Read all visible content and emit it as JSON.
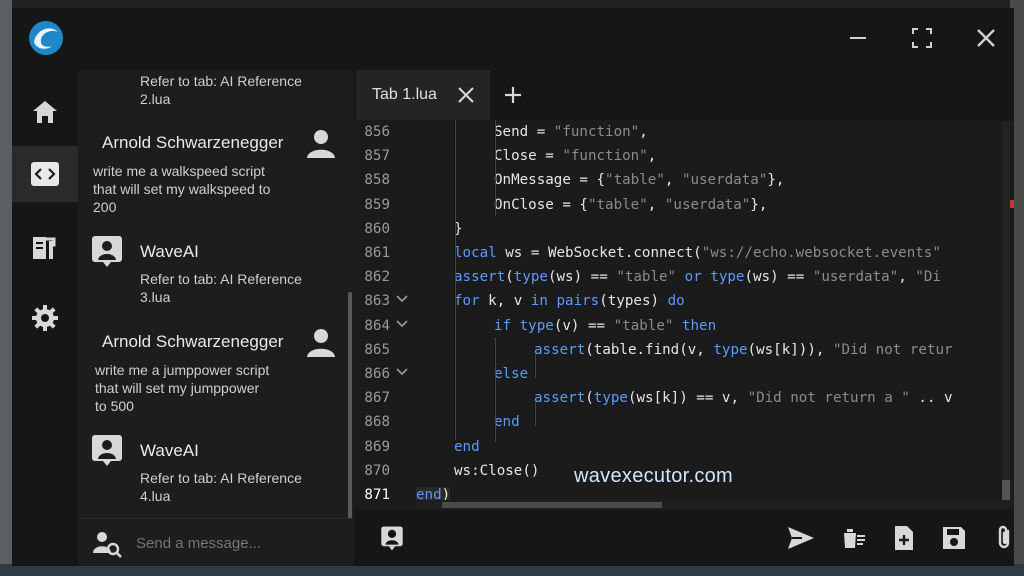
{
  "window": {
    "controls": {
      "minimize_icon": "minimize-icon",
      "maximize_icon": "maximize-icon",
      "close_icon": "close-icon"
    }
  },
  "nav": {
    "items": [
      {
        "name": "home",
        "icon": "home-icon"
      },
      {
        "name": "editor",
        "icon": "code-icon",
        "active": true
      },
      {
        "name": "scripts",
        "icon": "script-hub-icon"
      },
      {
        "name": "settings",
        "icon": "gear-icon"
      }
    ]
  },
  "chat": {
    "messages": [
      {
        "sender": "",
        "text": "Refer to tab: AI Reference\n2.lua"
      },
      {
        "sender": "Arnold Schwarzenegger",
        "text": "write me a walkspeed script\nthat will set my walkspeed to\n200"
      },
      {
        "sender": "WaveAI",
        "text": "Refer to tab: AI Reference\n3.lua"
      },
      {
        "sender": "Arnold Schwarzenegger",
        "text": "write me a jumppower script\nthat will set my jumppower\nto 500"
      },
      {
        "sender": "WaveAI",
        "text": "Refer to tab: AI Reference\n4.lua"
      }
    ],
    "input_placeholder": "Send a message..."
  },
  "editor": {
    "tabs": [
      {
        "label": "Tab 1.lua"
      }
    ],
    "lines": [
      {
        "n": "856",
        "fold": "",
        "indent": 2,
        "html": "Send = <span class=\"str\">\"function\"</span>,"
      },
      {
        "n": "857",
        "fold": "",
        "indent": 2,
        "html": "Close = <span class=\"str\">\"function\"</span>,"
      },
      {
        "n": "858",
        "fold": "",
        "indent": 2,
        "html": "OnMessage = {<span class=\"str\">\"table\"</span>, <span class=\"str\">\"userdata\"</span>},"
      },
      {
        "n": "859",
        "fold": "",
        "indent": 2,
        "html": "OnClose = {<span class=\"str\">\"table\"</span>, <span class=\"str\">\"userdata\"</span>},"
      },
      {
        "n": "860",
        "fold": "",
        "indent": 1,
        "html": "}"
      },
      {
        "n": "861",
        "fold": "",
        "indent": 1,
        "html": "<span class=\"kw\">local</span> ws = WebSocket.connect(<span class=\"str\">\"ws://echo.websocket.events\"</span>"
      },
      {
        "n": "862",
        "fold": "",
        "indent": 1,
        "html": "<span class=\"kw\">assert</span>(<span class=\"kw\">type</span>(ws) == <span class=\"str\">\"table\"</span> <span class=\"kw\">or</span> <span class=\"kw\">type</span>(ws) == <span class=\"str\">\"userdata\"</span>, <span class=\"str\">\"Di</span>"
      },
      {
        "n": "863",
        "fold": "v",
        "indent": 1,
        "html": "<span class=\"kw\">for</span> k, v <span class=\"kw\">in</span> <span class=\"kw\">pairs</span>(types) <span class=\"kw\">do</span>"
      },
      {
        "n": "864",
        "fold": "v",
        "indent": 2,
        "html": "<span class=\"kw\">if</span> <span class=\"kw\">type</span>(v) == <span class=\"str\">\"table\"</span> <span class=\"kw\">then</span>"
      },
      {
        "n": "865",
        "fold": "",
        "indent": 3,
        "html": "<span class=\"kw\">assert</span>(table.find(v, <span class=\"kw\">type</span>(ws[k])), <span class=\"str\">\"Did not retur</span>"
      },
      {
        "n": "866",
        "fold": "v",
        "indent": 2,
        "html": "<span class=\"kw\">else</span>"
      },
      {
        "n": "867",
        "fold": "",
        "indent": 3,
        "html": "<span class=\"kw\">assert</span>(<span class=\"kw\">type</span>(ws[k]) == v, <span class=\"str\">\"Did not return a \"</span> .. v"
      },
      {
        "n": "868",
        "fold": "",
        "indent": 2,
        "html": "<span class=\"kw\">end</span>"
      },
      {
        "n": "869",
        "fold": "",
        "indent": 1,
        "html": "<span class=\"kw\">end</span>"
      },
      {
        "n": "870",
        "fold": "",
        "indent": 1,
        "html": "ws:Close()"
      },
      {
        "n": "871",
        "fold": "",
        "indent": 0,
        "html": "<span class=\"kw\">end</span>)",
        "current": true
      }
    ],
    "watermark": "wavexecutor.com"
  },
  "bottom_bar": {
    "icons": [
      "ai-chat-icon",
      "execute-icon",
      "clear-icon",
      "open-file-icon",
      "save-icon",
      "attach-icon"
    ]
  },
  "colors": {
    "keyword": "#5b9bff",
    "string": "#8b8b8b",
    "background": "#141414"
  }
}
